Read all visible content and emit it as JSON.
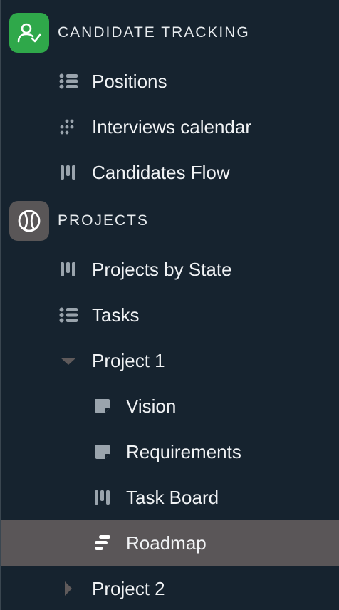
{
  "sections": [
    {
      "title": "CANDIDATE TRACKING",
      "icon": "person-check-icon",
      "icon_bg": "#2fa84a",
      "items": [
        {
          "label": "Positions",
          "icon": "list-icon"
        },
        {
          "label": "Interviews calendar",
          "icon": "calendar-dots-icon"
        },
        {
          "label": "Candidates Flow",
          "icon": "kanban-icon"
        }
      ]
    },
    {
      "title": "PROJECTS",
      "icon": "ball-icon",
      "icon_bg": "#595657",
      "items": [
        {
          "label": "Projects by State",
          "icon": "kanban-icon"
        },
        {
          "label": "Tasks",
          "icon": "list-icon"
        },
        {
          "label": "Project 1",
          "icon": "triangle-down-icon",
          "expanded": true,
          "children": [
            {
              "label": "Vision",
              "icon": "page-icon"
            },
            {
              "label": "Requirements",
              "icon": "page-icon"
            },
            {
              "label": "Task Board",
              "icon": "kanban-icon"
            },
            {
              "label": "Roadmap",
              "icon": "roadmap-icon",
              "selected": true
            }
          ]
        },
        {
          "label": "Project 2",
          "icon": "triangle-right-icon",
          "expanded": false
        }
      ]
    }
  ],
  "colors": {
    "background": "#16232f",
    "selected": "#5a5658",
    "icon": "#9aa4ad",
    "text": "#f1f3f5"
  }
}
